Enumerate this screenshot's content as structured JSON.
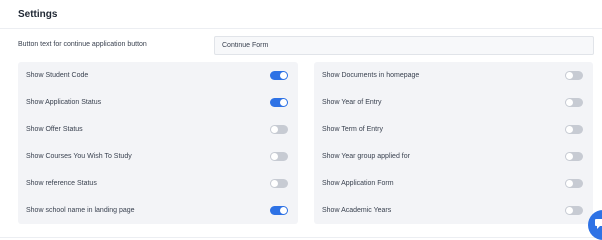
{
  "page": {
    "title": "Settings"
  },
  "continue_button": {
    "label": "Button text for continue application button",
    "value": "Continue Form"
  },
  "left_settings": [
    {
      "label": "Show Student Code",
      "enabled": true
    },
    {
      "label": "Show Application Status",
      "enabled": true
    },
    {
      "label": "Show Offer Status",
      "enabled": false
    },
    {
      "label": "Show Courses You Wish To Study",
      "enabled": false
    },
    {
      "label": "Show reference Status",
      "enabled": false
    },
    {
      "label": "Show school name in landing page",
      "enabled": true
    }
  ],
  "right_settings": [
    {
      "label": "Show Documents in homepage",
      "enabled": false
    },
    {
      "label": "Show Year of Entry",
      "enabled": false
    },
    {
      "label": "Show Term of Entry",
      "enabled": false
    },
    {
      "label": "Show Year group applied for",
      "enabled": false
    },
    {
      "label": "Show Application Form",
      "enabled": false
    },
    {
      "label": "Show Academic Years",
      "enabled": false
    }
  ],
  "colors": {
    "toggle_on": "#2e72e5",
    "toggle_off": "#c7cbd3",
    "panel_bg": "#f3f4f7"
  },
  "icons": {
    "chat_button": "chat-icon"
  }
}
